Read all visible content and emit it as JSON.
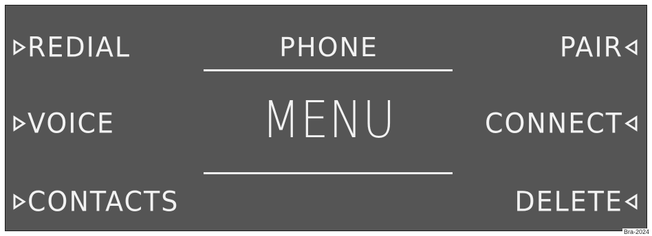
{
  "display": {
    "title": "PHONE",
    "subtitle": "MENU",
    "left_keys": [
      {
        "label": "REDIAL"
      },
      {
        "label": "VOICE"
      },
      {
        "label": "CONTACTS"
      }
    ],
    "right_keys": [
      {
        "label": "PAIR"
      },
      {
        "label": "CONNECT"
      },
      {
        "label": "DELETE"
      }
    ]
  },
  "image_code": "Bra-2024",
  "colors": {
    "screen_bg": "#555555",
    "text": "#f2f2f2"
  },
  "icons": {
    "left_arrow": "triangle-right-outline-icon",
    "right_arrow": "triangle-left-outline-icon"
  }
}
